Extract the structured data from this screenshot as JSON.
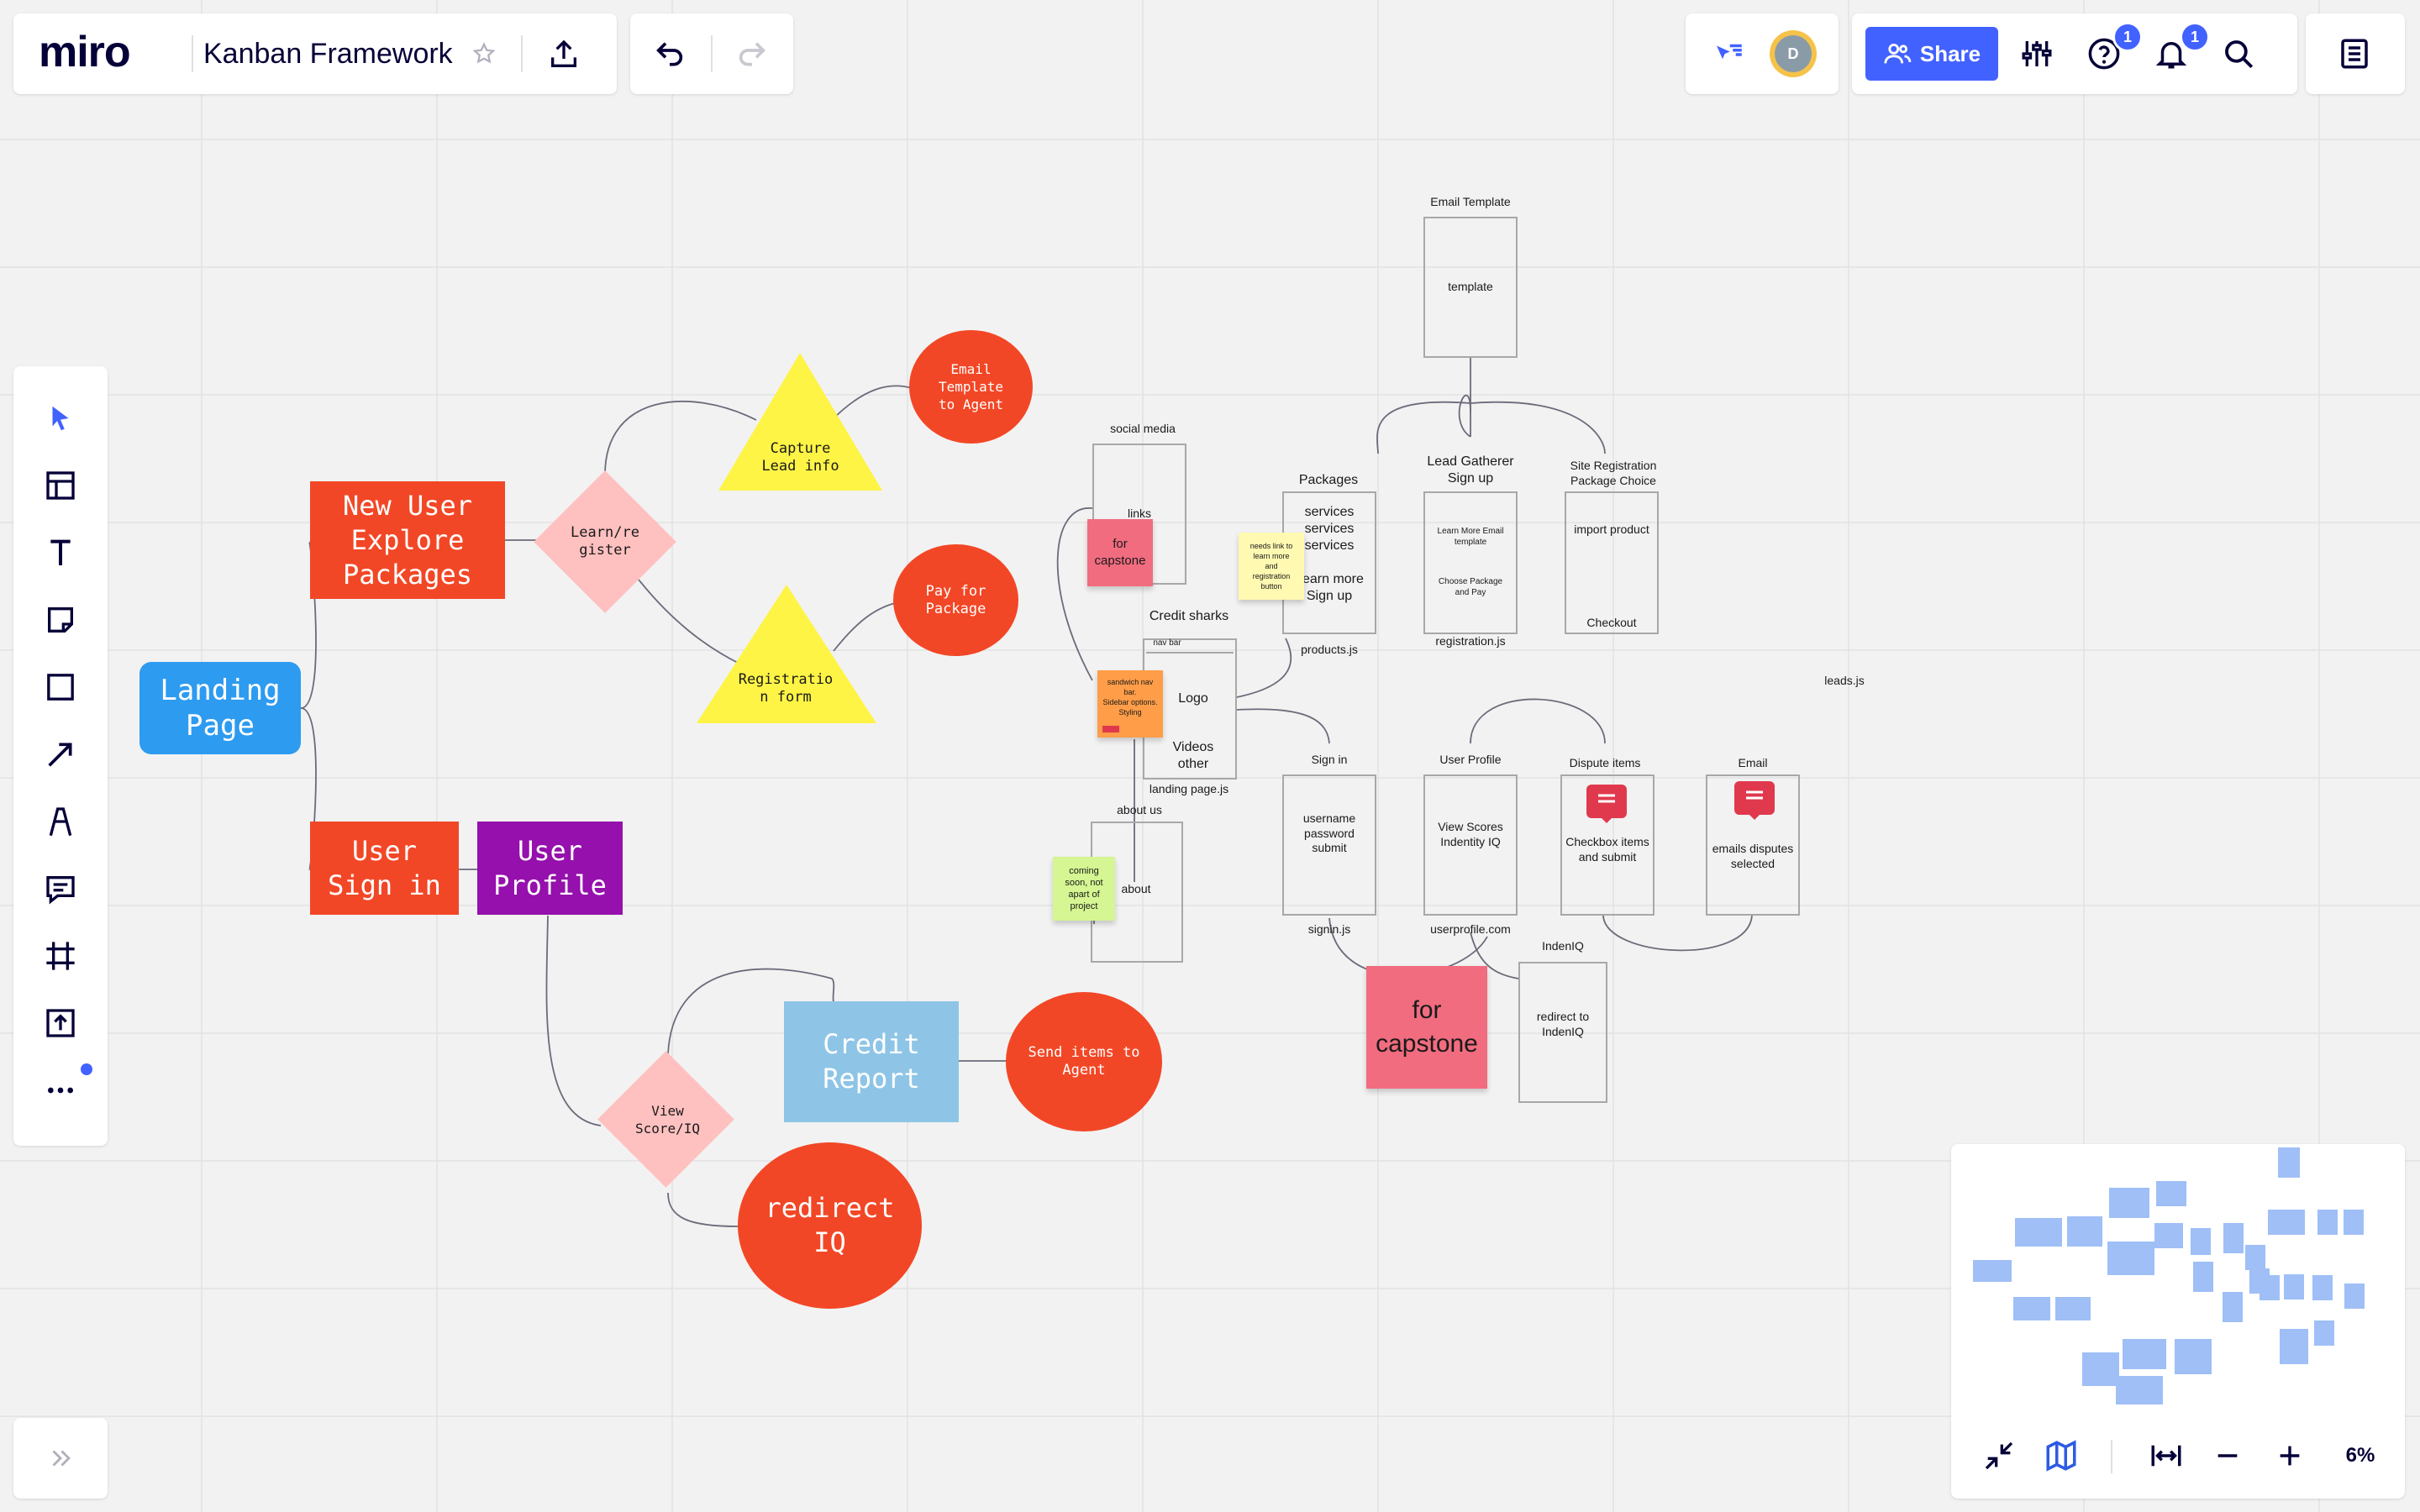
{
  "toolbar": {
    "logo": "miro",
    "board_title": "Kanban Framework",
    "share_label": "Share",
    "help_badge": "1",
    "notif_badge": "1",
    "avatar_initial": "D"
  },
  "zoom": {
    "level": "6%"
  },
  "flow": {
    "landing": "Landing\nPage",
    "new_user": "New User\nExplore\nPackages",
    "learn": "Learn/re\ngister",
    "capture": "Capture\nLead info",
    "email_agent": "Email\nTemplate\nto Agent",
    "registration": "Registratio\nn form",
    "pay": "Pay for\nPackage",
    "user_signin": "User\nSign in",
    "user_profile": "User\nProfile",
    "credit_report": "Credit\nReport",
    "send_items": "Send items to\nAgent",
    "view_score": "View\nScore/IQ",
    "redirect_iq": "redirect\nIQ"
  },
  "wireframe": {
    "social_media": "social media",
    "links": "links",
    "credit_sharks": "Credit sharks",
    "nav_bar": "nav bar",
    "logo": "Logo",
    "videos_other": "Videos\nother",
    "landing_page_js": "landing page.js",
    "about_us": "about us",
    "about": "about",
    "packages": "Packages",
    "packages_body": "services\nservices\nservices",
    "learn_more": "Learn more\nSign up",
    "products_js": "products.js",
    "email_template": "Email Template",
    "template": "template",
    "lead_gatherer": "Lead Gatherer\nSign up",
    "learn_more_email": "Learn More Email\ntemplate",
    "choose_package": "Choose Package\nand Pay",
    "registration_js": "registration.js",
    "site_registration": "Site Registration\nPackage Choice",
    "import_product": "import product",
    "checkout": "Checkout",
    "leads_js": "leads.js",
    "sign_in": "Sign in",
    "signin_body": "username\npassword\nsubmit",
    "signin_js": "signin.js",
    "user_profile": "User Profile",
    "profile_body": "View Scores\nIndentity IQ",
    "userprofile_com": "userprofile.com",
    "dispute_items": "Dispute items",
    "dispute_body": "Checkbox items\nand submit",
    "email": "Email",
    "email_body": "emails disputes\nselected",
    "indeniq": "IndenIQ",
    "redirect_indeniq": "redirect to\nIndenIQ"
  },
  "stickies": {
    "capstone_small": "for\ncapstone",
    "capstone_big": "for\ncapstone",
    "needs_link": "needs link to\nlearn more\nand\nregistration\nbutton",
    "sandwich": "sandwich nav\nbar.\nSidebar options.\nStyling",
    "coming_soon": "coming\nsoon, not\napart of\nproject"
  },
  "left_tools": [
    {
      "name": "select-tool",
      "icon": "cursor-icon"
    },
    {
      "name": "templates-tool",
      "icon": "layout-icon"
    },
    {
      "name": "text-tool",
      "icon": "text-icon"
    },
    {
      "name": "sticky-note-tool",
      "icon": "sticky-note-icon"
    },
    {
      "name": "shape-tool",
      "icon": "square-icon"
    },
    {
      "name": "connection-line-tool",
      "icon": "arrow-icon"
    },
    {
      "name": "pen-tool",
      "icon": "pen-icon"
    },
    {
      "name": "comment-tool",
      "icon": "comment-icon"
    },
    {
      "name": "frame-tool",
      "icon": "frame-icon"
    },
    {
      "name": "upload-tool",
      "icon": "upload-icon"
    },
    {
      "name": "more-tools",
      "icon": "more-icon"
    }
  ],
  "colors": {
    "accent": "#4262ff",
    "red": "#f24726",
    "blue": "#2d9bf0",
    "purple": "#9510ac",
    "yellow": "#fef445",
    "pink_diamond": "#ffc0c0",
    "light_blue": "#8ec5e6",
    "sticky_pink": "#f16c7f",
    "sticky_yellow": "#fff9b1",
    "sticky_orange": "#ff9d48",
    "sticky_green": "#d5f692"
  }
}
